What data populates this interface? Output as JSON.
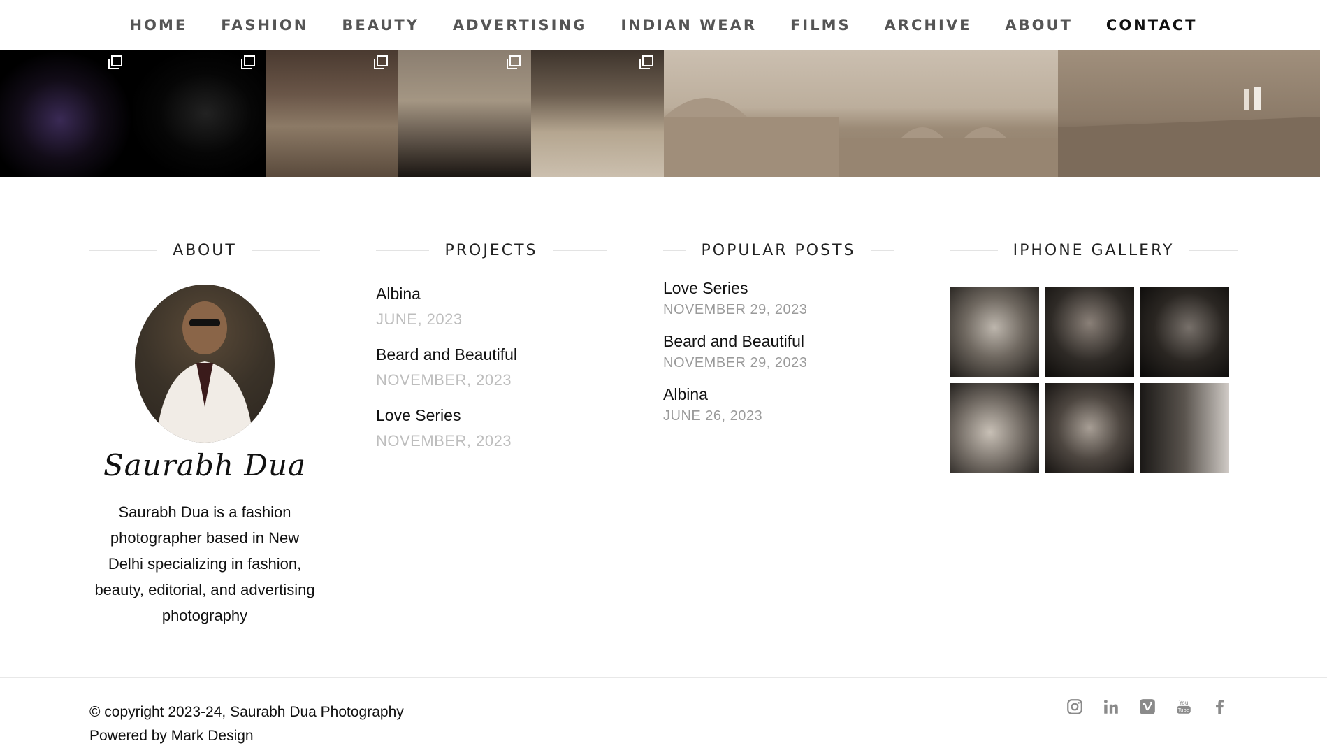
{
  "nav": {
    "items": [
      "HOME",
      "FASHION",
      "BEAUTY",
      "ADVERTISING",
      "INDIAN WEAR",
      "FILMS",
      "ARCHIVE",
      "ABOUT",
      "CONTACT"
    ],
    "active": "CONTACT"
  },
  "instagram_strip": {
    "tiles": [
      {
        "multi_icon": "stacked-squares-icon"
      },
      {
        "multi_icon": "stacked-squares-icon"
      },
      {
        "multi_icon": "stacked-squares-icon"
      },
      {
        "multi_icon": "stacked-squares-icon"
      },
      {
        "multi_icon": "stacked-squares-icon"
      },
      {
        "multi_icon": ""
      },
      {
        "multi_icon": ""
      }
    ]
  },
  "about": {
    "title": "ABOUT",
    "signature": "Saurabh Dua",
    "text": "Saurabh Dua is a fashion photographer based in New Delhi specializing in fashion, beauty, editorial, and advertising photography"
  },
  "projects": {
    "title": "PROJECTS",
    "items": [
      {
        "title": "Albina",
        "date": "JUNE, 2023"
      },
      {
        "title": "Beard and Beautiful",
        "date": "NOVEMBER, 2023"
      },
      {
        "title": "Love Series",
        "date": "NOVEMBER, 2023"
      }
    ]
  },
  "popular_posts": {
    "title": "POPULAR POSTS",
    "items": [
      {
        "title": "Love Series",
        "date": "NOVEMBER 29, 2023"
      },
      {
        "title": "Beard and Beautiful",
        "date": "NOVEMBER 29, 2023"
      },
      {
        "title": "Albina",
        "date": "JUNE 26, 2023"
      }
    ]
  },
  "iphone_gallery": {
    "title": "IPHONE GALLERY"
  },
  "footer": {
    "copyright": "© copyright 2023-24, Saurabh Dua Photography",
    "powered": "Powered by Mark Design",
    "social": [
      "instagram-icon",
      "linkedin-icon",
      "vimeo-icon",
      "youtube-icon",
      "facebook-icon"
    ],
    "social_color": "#8a8a8a"
  }
}
